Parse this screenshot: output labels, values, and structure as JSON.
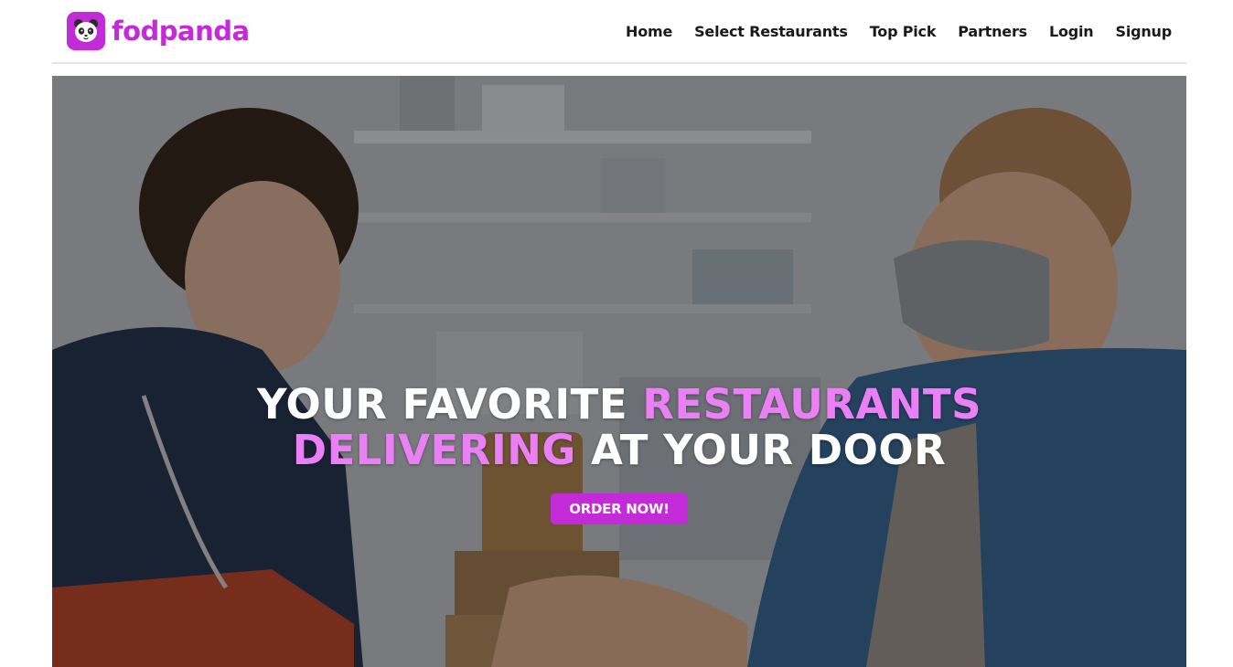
{
  "brand": {
    "name": "fodpanda",
    "logo_icon": "panda-face-icon",
    "color": "#c32ad8"
  },
  "nav": {
    "items": [
      {
        "label": "Home"
      },
      {
        "label": "Select Restaurants"
      },
      {
        "label": "Top Pick"
      },
      {
        "label": "Partners"
      },
      {
        "label": "Login"
      },
      {
        "label": "Signup"
      }
    ]
  },
  "hero": {
    "line1_plain": "YOUR FAVORITE",
    "line1_accent": "RESTAURANTS",
    "line2_accent": "DELIVERING",
    "line2_plain": "AT YOUR DOOR",
    "cta_label": "ORDER NOW!",
    "accent_color": "#ea7ff6"
  }
}
